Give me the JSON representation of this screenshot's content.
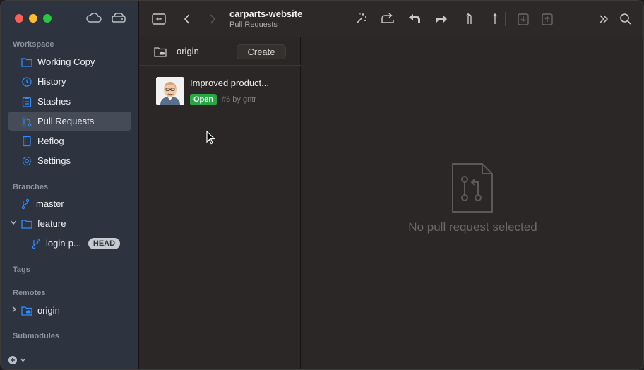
{
  "colors": {
    "sidebar_bg": "#2d3440",
    "accent_blue": "#2f8cff",
    "open_badge": "#28a745",
    "selected_bg": "#454c58"
  },
  "sidebar": {
    "workspace_label": "Workspace",
    "workspace_items": [
      {
        "label": "Working Copy",
        "icon": "folder-icon"
      },
      {
        "label": "History",
        "icon": "clock-icon"
      },
      {
        "label": "Stashes",
        "icon": "clipboard-icon"
      },
      {
        "label": "Pull Requests",
        "icon": "pull-request-icon",
        "selected": true
      },
      {
        "label": "Reflog",
        "icon": "book-icon"
      },
      {
        "label": "Settings",
        "icon": "gear-icon"
      }
    ],
    "branches_label": "Branches",
    "branches": {
      "master": "master",
      "feature": "feature",
      "login": "login-p...",
      "head_badge": "HEAD"
    },
    "tags_label": "Tags",
    "remotes_label": "Remotes",
    "remote_origin": "origin",
    "submodules_label": "Submodules"
  },
  "toolbar": {
    "title": "carparts-website",
    "subtitle": "Pull Requests"
  },
  "list": {
    "remote": "origin",
    "create_label": "Create",
    "items": [
      {
        "title": "Improved product...",
        "status": "Open",
        "meta": "#6 by gntr"
      }
    ]
  },
  "detail": {
    "empty_text": "No pull request selected"
  }
}
